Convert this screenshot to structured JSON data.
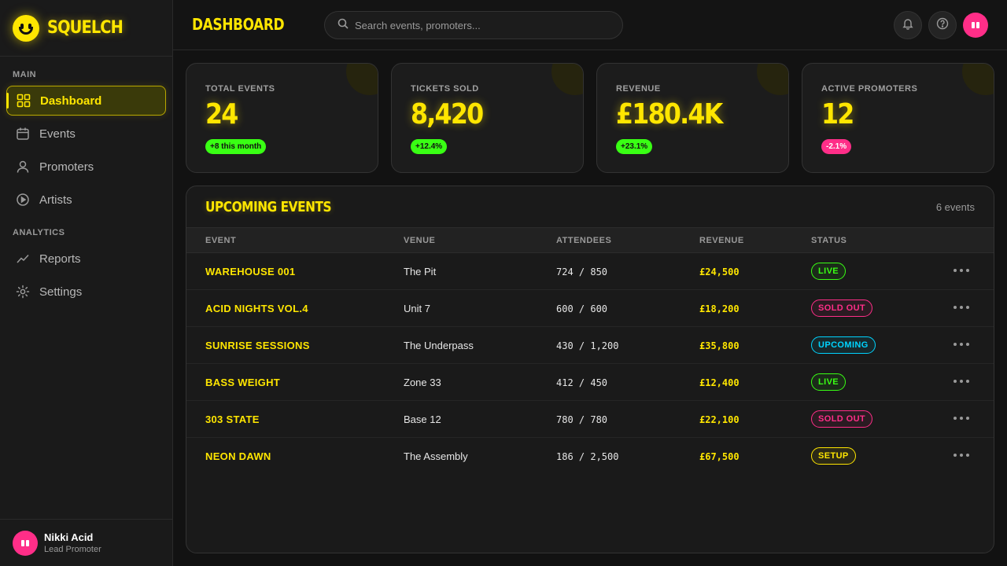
{
  "brand": {
    "name": "SQUELCH"
  },
  "sidebar": {
    "sections": [
      {
        "label": "MAIN"
      },
      {
        "label": "ANALYTICS"
      }
    ],
    "items": [
      {
        "label": "Dashboard",
        "icon": "grid-icon",
        "active": true
      },
      {
        "label": "Events",
        "icon": "calendar-icon"
      },
      {
        "label": "Promoters",
        "icon": "user-icon"
      },
      {
        "label": "Artists",
        "icon": "play-circle-icon"
      },
      {
        "label": "Reports",
        "icon": "trend-line-icon"
      },
      {
        "label": "Settings",
        "icon": "gear-icon"
      }
    ],
    "user": {
      "name": "Nikki Acid",
      "role": "Lead Promoter"
    }
  },
  "header": {
    "title": "DASHBOARD",
    "search_placeholder": "Search events, promoters..."
  },
  "stats": [
    {
      "label": "TOTAL EVENTS",
      "value": "24",
      "delta": "+8 this month",
      "trend": "up"
    },
    {
      "label": "TICKETS SOLD",
      "value": "8,420",
      "delta": "+12.4%",
      "trend": "up"
    },
    {
      "label": "REVENUE",
      "value": "£180.4K",
      "delta": "+23.1%",
      "trend": "up"
    },
    {
      "label": "ACTIVE PROMOTERS",
      "value": "12",
      "delta": "-2.1%",
      "trend": "down"
    }
  ],
  "events": {
    "title": "UPCOMING EVENTS",
    "count": "6 events",
    "columns": [
      "EVENT",
      "VENUE",
      "ATTENDEES",
      "REVENUE",
      "STATUS"
    ],
    "rows": [
      {
        "event": "WAREHOUSE 001",
        "venue": "The Pit",
        "attendees": "724 / 850",
        "revenue": "£24,500",
        "status": "LIVE"
      },
      {
        "event": "ACID NIGHTS VOL.4",
        "venue": "Unit 7",
        "attendees": "600 / 600",
        "revenue": "£18,200",
        "status": "SOLD OUT"
      },
      {
        "event": "SUNRISE SESSIONS",
        "venue": "The Underpass",
        "attendees": "430 / 1,200",
        "revenue": "£35,800",
        "status": "UPCOMING"
      },
      {
        "event": "BASS WEIGHT",
        "venue": "Zone 33",
        "attendees": "412 / 450",
        "revenue": "£12,400",
        "status": "LIVE"
      },
      {
        "event": "303 STATE",
        "venue": "Base 12",
        "attendees": "780 / 780",
        "revenue": "£22,100",
        "status": "SOLD OUT"
      },
      {
        "event": "NEON DAWN",
        "venue": "The Assembly",
        "attendees": "186 / 2,500",
        "revenue": "£67,500",
        "status": "SETUP"
      }
    ]
  },
  "colors": {
    "accent": "#ffe600",
    "live": "#39ff14",
    "sold_out": "#ff2e88",
    "upcoming": "#00d4ff",
    "background": "#121212"
  }
}
